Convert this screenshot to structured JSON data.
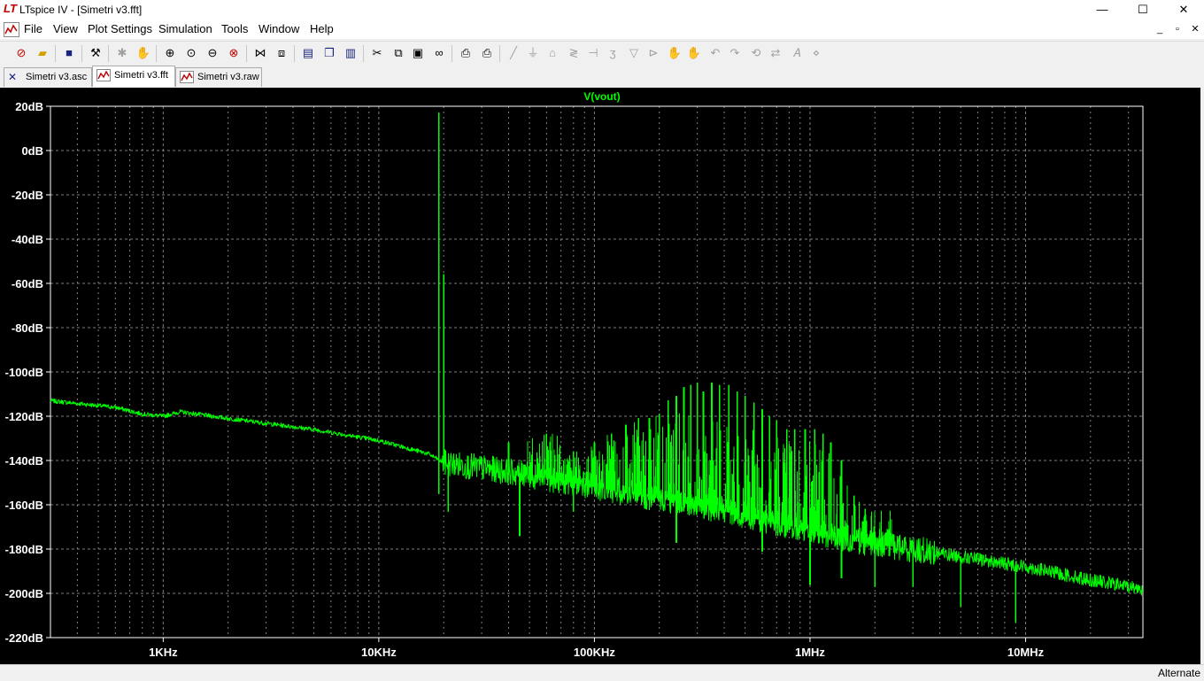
{
  "window": {
    "title": "LTspice IV - [Simetri v3.fft]",
    "app_icon": "LT",
    "minimize": "—",
    "maximize": "☐",
    "close": "✕"
  },
  "menu": {
    "items": [
      "File",
      "View",
      "Plot Settings",
      "Simulation",
      "Tools",
      "Window",
      "Help"
    ],
    "mdi_minimize": "_",
    "mdi_restore": "▫",
    "mdi_close": "✕"
  },
  "tabs": [
    {
      "label": "Simetri v3.asc",
      "icon": "schematic-icon",
      "active": false
    },
    {
      "label": "Simetri v3.fft",
      "icon": "waveform-icon",
      "active": true
    },
    {
      "label": "Simetri v3.raw",
      "icon": "waveform-icon",
      "active": false
    }
  ],
  "status": {
    "mode": "Alternate"
  },
  "colors": {
    "trace": "#00ff00",
    "background": "#000000",
    "axis_text": "#ffffff",
    "grid": "#808080"
  },
  "chart_data": {
    "type": "line",
    "title": "V(vout)",
    "xlabel": "",
    "ylabel": "",
    "xscale": "log",
    "xlim_hz": [
      300,
      35000000
    ],
    "ylim_db": [
      -220,
      20
    ],
    "grid": true,
    "x_tick_labels": [
      "1KHz",
      "10KHz",
      "100KHz",
      "1MHz",
      "10MHz"
    ],
    "y_tick_labels": [
      "20dB",
      "0dB",
      "-20dB",
      "-40dB",
      "-60dB",
      "-80dB",
      "-100dB",
      "-120dB",
      "-140dB",
      "-160dB",
      "-180dB",
      "-200dB",
      "-220dB"
    ],
    "series": [
      {
        "name": "V(vout)",
        "floor_points_hz_db": [
          [
            300,
            -113
          ],
          [
            600,
            -116
          ],
          [
            800,
            -119
          ],
          [
            1000,
            -120
          ],
          [
            1200,
            -118
          ],
          [
            2000,
            -121
          ],
          [
            5000,
            -126
          ],
          [
            10000,
            -131
          ],
          [
            17000,
            -137
          ],
          [
            20000,
            -141
          ],
          [
            40000,
            -145
          ],
          [
            80000,
            -150
          ],
          [
            150000,
            -155
          ],
          [
            300000,
            -160
          ],
          [
            600000,
            -167
          ],
          [
            1000000,
            -171
          ],
          [
            1500000,
            -176
          ],
          [
            3000000,
            -180
          ],
          [
            10000000,
            -188
          ],
          [
            20000000,
            -194
          ],
          [
            35000000,
            -198
          ]
        ],
        "peaks_hz_db": [
          [
            19000,
            17
          ],
          [
            20000,
            -56
          ],
          [
            40000,
            -132
          ],
          [
            60000,
            -128
          ],
          [
            80000,
            -136
          ],
          [
            100000,
            -132
          ],
          [
            120000,
            -128
          ],
          [
            140000,
            -124
          ],
          [
            160000,
            -121
          ],
          [
            180000,
            -121
          ],
          [
            200000,
            -119
          ],
          [
            220000,
            -113
          ],
          [
            240000,
            -111
          ],
          [
            260000,
            -107
          ],
          [
            280000,
            -106
          ],
          [
            300000,
            -105
          ],
          [
            320000,
            -109
          ],
          [
            350000,
            -105
          ],
          [
            380000,
            -106
          ],
          [
            420000,
            -106
          ],
          [
            460000,
            -109
          ],
          [
            500000,
            -111
          ],
          [
            550000,
            -114
          ],
          [
            600000,
            -117
          ],
          [
            650000,
            -120
          ],
          [
            700000,
            -122
          ],
          [
            780000,
            -126
          ],
          [
            850000,
            -126
          ],
          [
            950000,
            -126
          ],
          [
            1050000,
            -126
          ],
          [
            1150000,
            -128
          ],
          [
            1250000,
            -132
          ],
          [
            1400000,
            -140
          ],
          [
            1600000,
            -156
          ],
          [
            1800000,
            -162
          ]
        ],
        "dips_hz_db": [
          [
            19000,
            -155
          ],
          [
            21000,
            -163
          ],
          [
            45000,
            -174
          ],
          [
            80000,
            -163
          ],
          [
            240000,
            -177
          ],
          [
            600000,
            -181
          ],
          [
            1000000,
            -196
          ],
          [
            1400000,
            -193
          ],
          [
            2000000,
            -197
          ],
          [
            3000000,
            -197
          ],
          [
            5000000,
            -206
          ],
          [
            9000000,
            -213
          ]
        ]
      }
    ]
  }
}
